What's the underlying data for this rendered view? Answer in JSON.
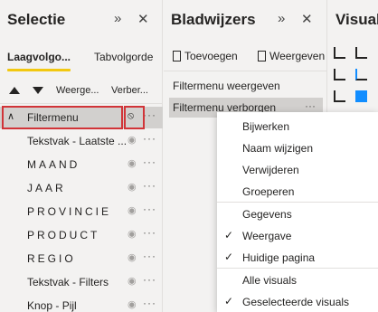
{
  "selection": {
    "title": "Selectie",
    "tabs": [
      "Laagvolgo...",
      "Tabvolgorde"
    ],
    "show_label": "Weerge...",
    "hide_label": "Verber...",
    "items": [
      {
        "label": "Filtermenu",
        "spaced": false
      },
      {
        "label": "Tekstvak - Laatste ...",
        "spaced": false
      },
      {
        "label": "MAAND",
        "spaced": true
      },
      {
        "label": "JAAR",
        "spaced": true
      },
      {
        "label": "PROVINCIE",
        "spaced": true
      },
      {
        "label": "PRODUCT",
        "spaced": true
      },
      {
        "label": "REGIO",
        "spaced": true
      },
      {
        "label": "Tekstvak - Filters",
        "spaced": false
      },
      {
        "label": "Knop - Pijl",
        "spaced": false
      }
    ]
  },
  "bookmarks": {
    "title": "Bladwijzers",
    "add_label": "Toevoegen",
    "view_label": "Weergeven",
    "items": [
      "Filtermenu weergeven",
      "Filtermenu verborgen"
    ]
  },
  "visuals": {
    "title": "Visual"
  },
  "menu": {
    "items": [
      "Bijwerken",
      "Naam wijzigen",
      "Verwijderen",
      "Groeperen",
      "Gegevens",
      "Weergave",
      "Huidige pagina",
      "Alle visuals",
      "Geselecteerde visuals"
    ],
    "checked": [
      "Weergave",
      "Huidige pagina",
      "Geselecteerde visuals"
    ]
  },
  "colors": {
    "accent": "#f2c811",
    "highlight_border": "#d13438",
    "icon_blue": "#118dff"
  }
}
